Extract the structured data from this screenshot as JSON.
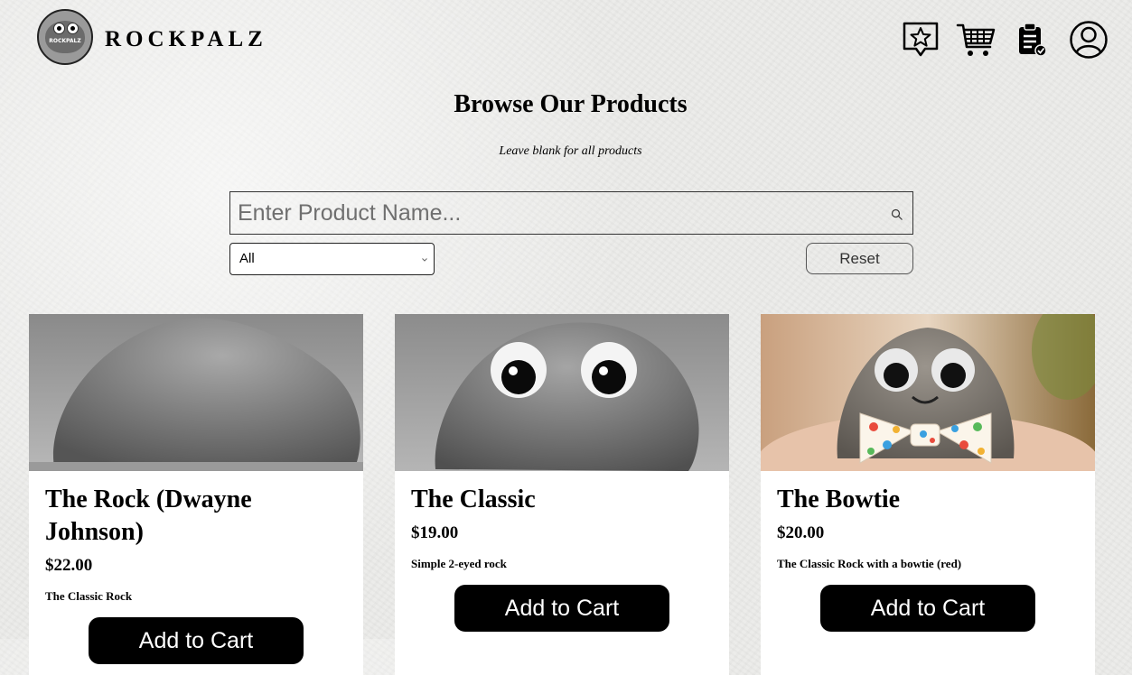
{
  "brand": {
    "logo_text": "ROCKPALZ",
    "name": "ROCKPALZ"
  },
  "header_icons": [
    "reviews-star-icon",
    "shopping-cart-icon",
    "orders-clipboard-icon",
    "user-profile-icon"
  ],
  "page": {
    "title": "Browse Our Products",
    "hint": "Leave blank for all products"
  },
  "search": {
    "placeholder": "Enter Product Name...",
    "value": ""
  },
  "filter": {
    "selected": "All"
  },
  "reset_label": "Reset",
  "products": [
    {
      "name": "The Rock (Dwayne Johnson)",
      "price": "$22.00",
      "description": "The Classic Rock",
      "button": "Add to Cart"
    },
    {
      "name": "The Classic",
      "price": "$19.00",
      "description": "Simple 2-eyed rock",
      "button": "Add to Cart"
    },
    {
      "name": "The Bowtie",
      "price": "$20.00",
      "description": "The Classic Rock with a bowtie (red)",
      "button": "Add to Cart"
    }
  ],
  "colors": {
    "button_bg": "#000000",
    "card_bg": "#ffffff",
    "page_bg": "#ececea"
  }
}
